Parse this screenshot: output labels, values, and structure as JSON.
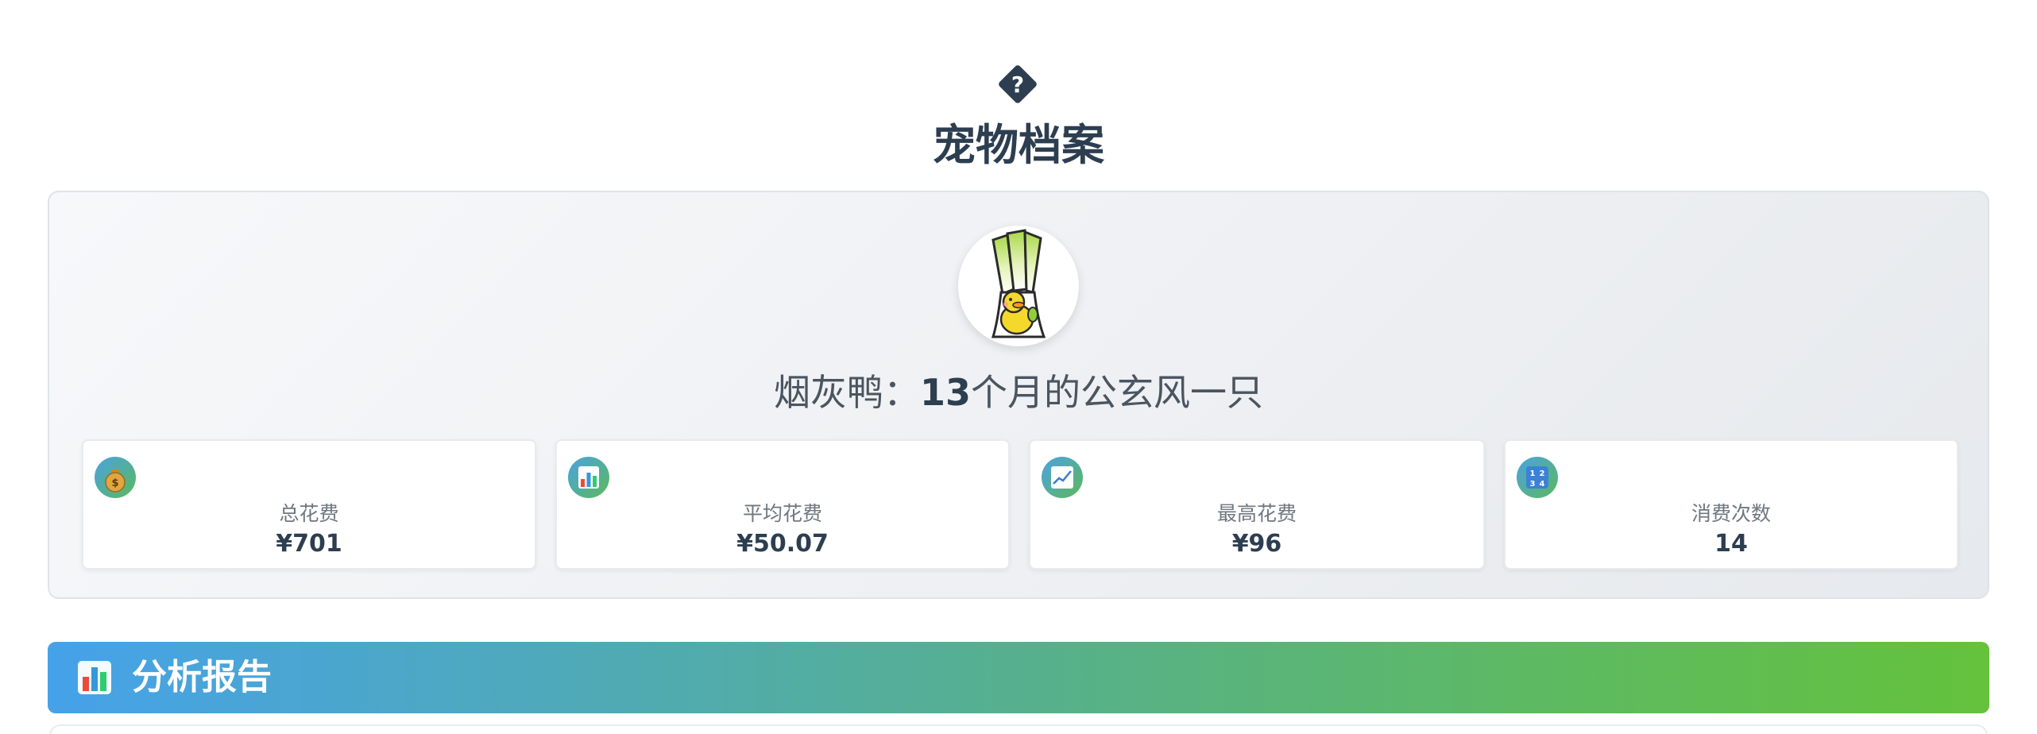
{
  "header": {
    "icon": "question-diamond-icon",
    "title": "宠物档案"
  },
  "pet": {
    "avatar": "leek-duck-avatar",
    "name_prefix": "烟灰鸭：",
    "age": "13",
    "description": "个月的公玄风一只"
  },
  "stats": [
    {
      "icon": "money-bag-icon",
      "label": "总花费",
      "value": "¥701"
    },
    {
      "icon": "bar-chart-icon",
      "label": "平均花费",
      "value": "¥50.07"
    },
    {
      "icon": "trend-up-icon",
      "label": "最高花费",
      "value": "¥96"
    },
    {
      "icon": "numbers-icon",
      "label": "消费次数",
      "value": "14"
    }
  ],
  "section": {
    "icon": "bar-chart-icon",
    "title": "分析报告"
  },
  "colors": {
    "title_text": "#2c3e50",
    "gradient_start": "#46a2e9",
    "gradient_end": "#64c23c"
  }
}
